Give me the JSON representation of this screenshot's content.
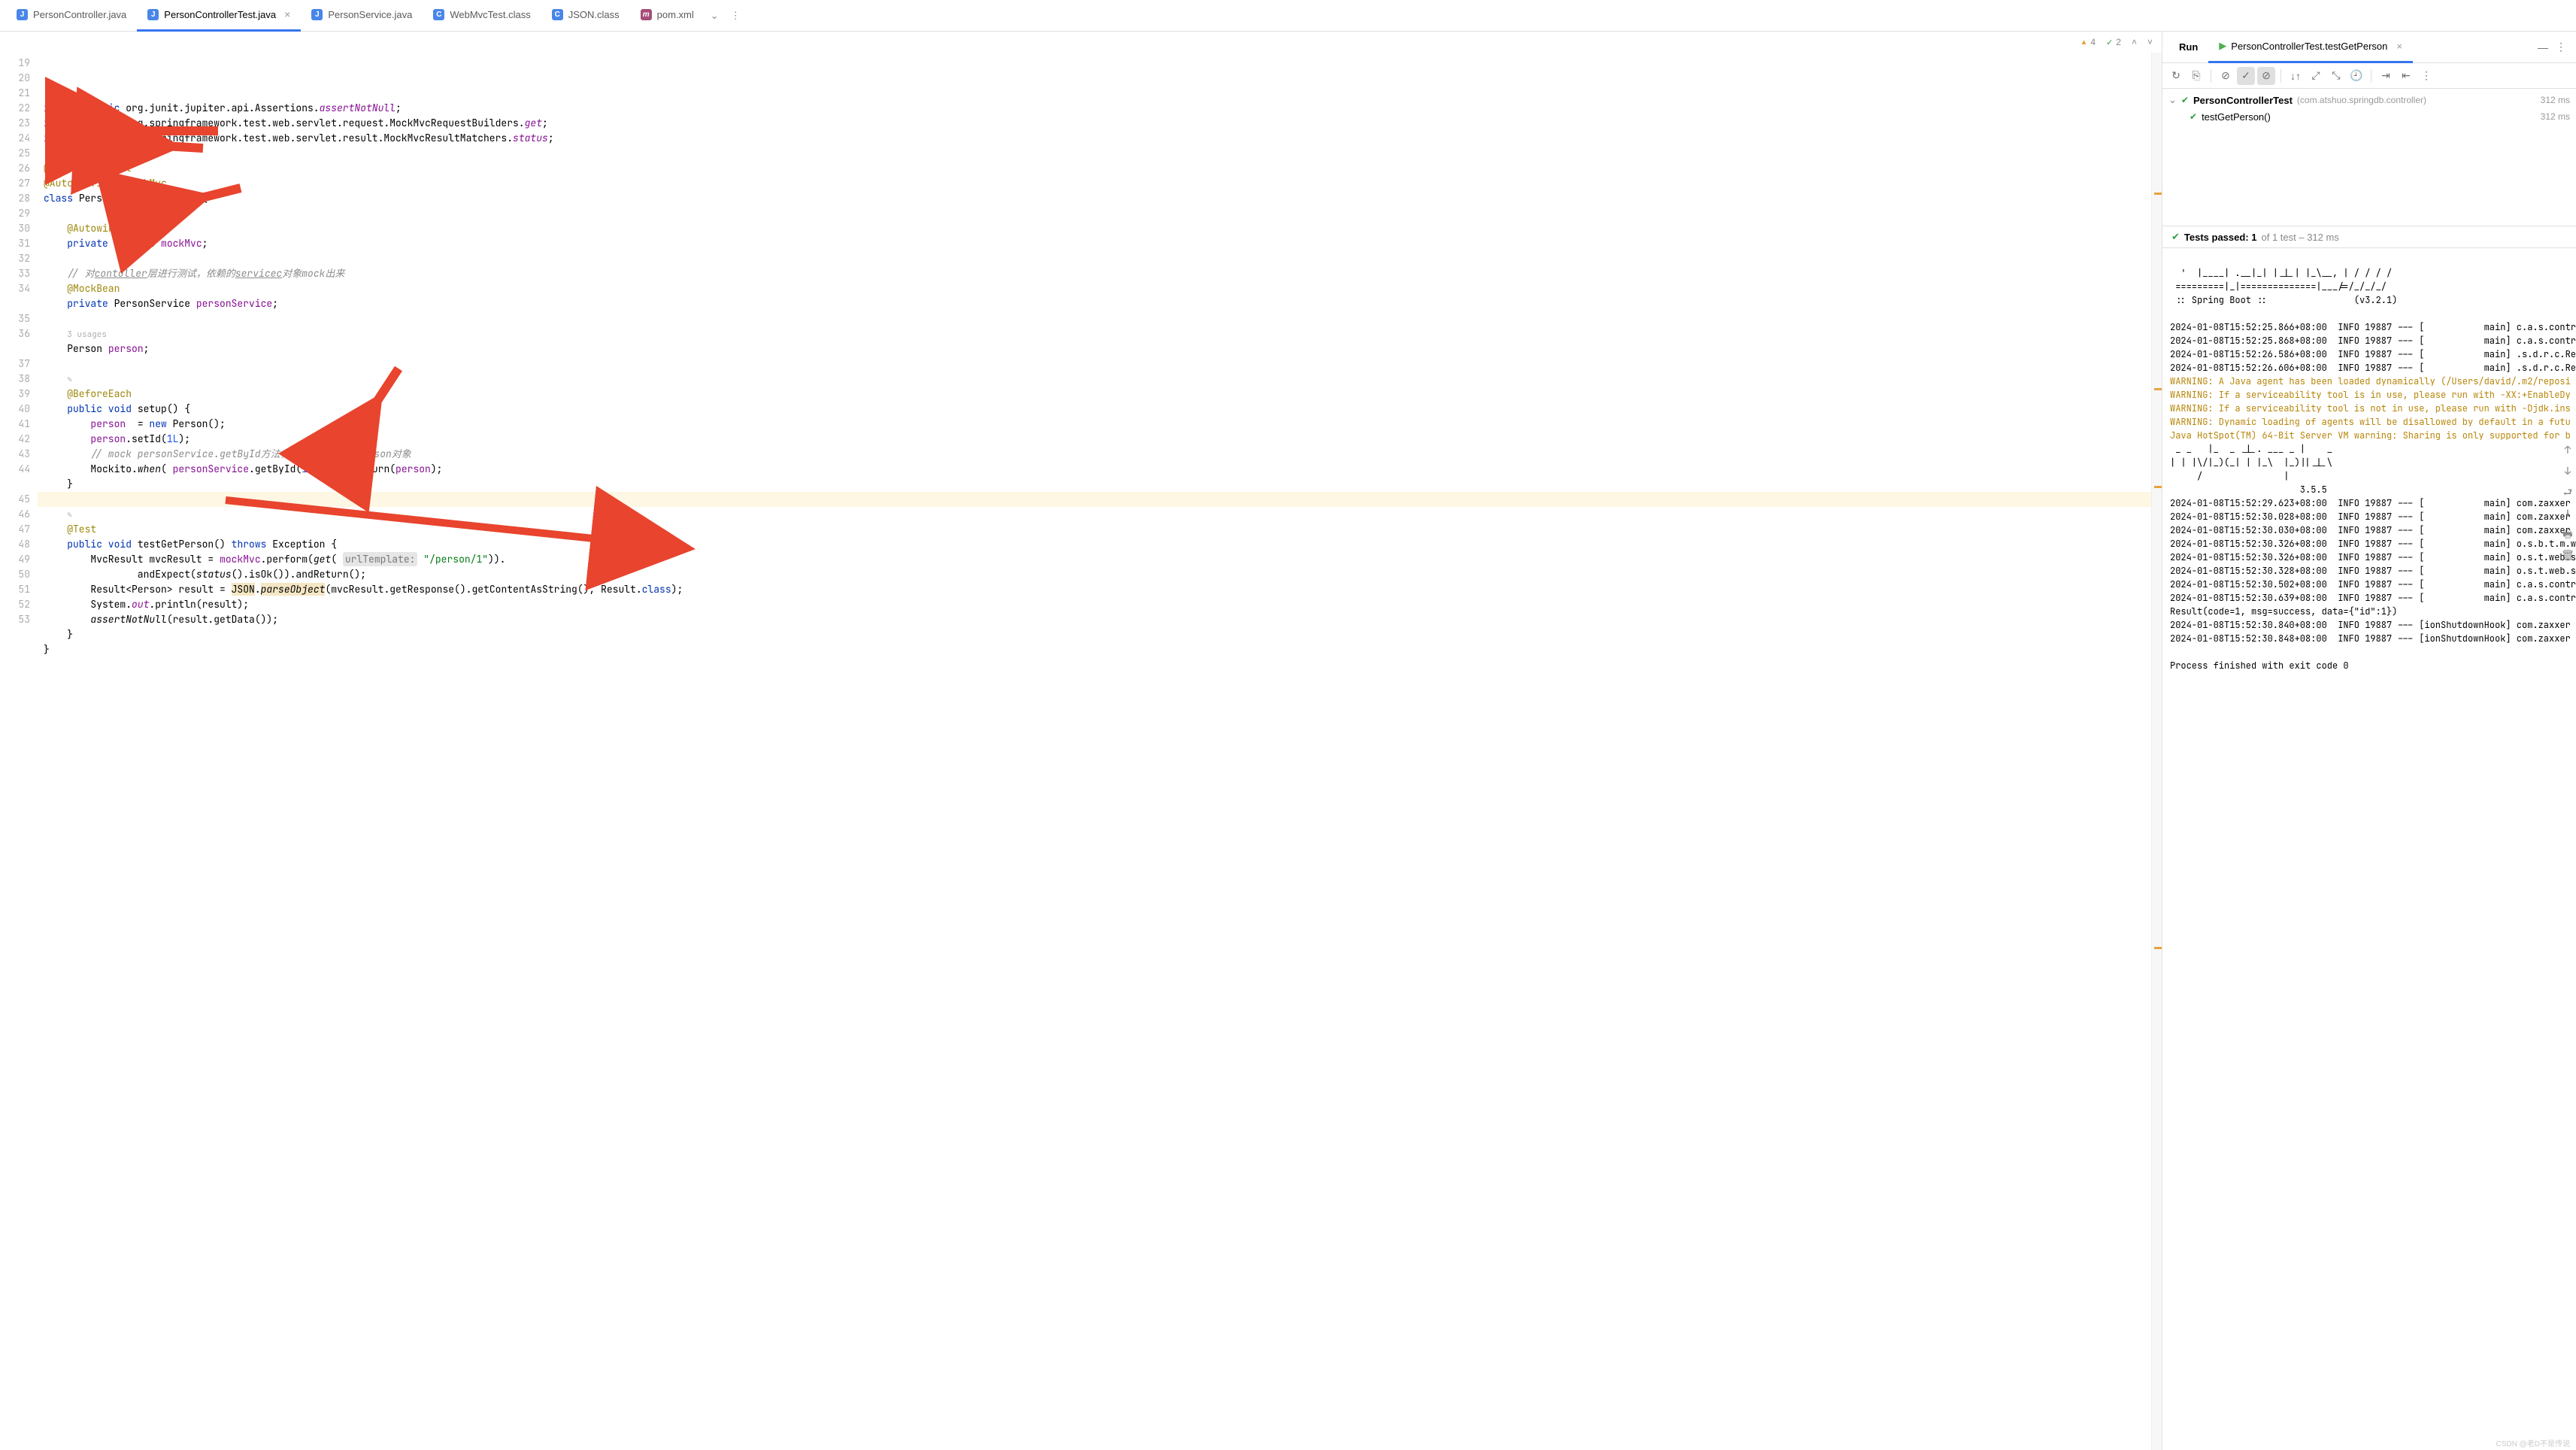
{
  "tabs": [
    {
      "icon": "java",
      "label": "PersonController.java"
    },
    {
      "icon": "java",
      "label": "PersonControllerTest.java",
      "active": true
    },
    {
      "icon": "java",
      "label": "PersonService.java"
    },
    {
      "icon": "cls",
      "label": "WebMvcTest.class"
    },
    {
      "icon": "cls",
      "label": "JSON.class"
    },
    {
      "icon": "m",
      "label": "pom.xml"
    }
  ],
  "editor": {
    "warn_count": "4",
    "ok_count": "2",
    "lines": [
      {
        "n": "19"
      },
      {
        "n": "20",
        "h": "<span class='k'>import static</span> org.junit.jupiter.api.Assertions.<span class='s-i'>assertNotNull</span>;"
      },
      {
        "n": "21",
        "h": "<span class='k'>import static</span> org.springframework.test.web.servlet.request.MockMvcRequestBuilders.<span class='s-i'>get</span>;"
      },
      {
        "n": "22",
        "h": "<span class='k'>import static</span> org.springframework.test.web.servlet.result.MockMvcResultMatchers.<span class='s-i'>status</span>;"
      },
      {
        "n": "23"
      },
      {
        "n": "24",
        "g": "r",
        "h": "<span class='ann'>@SpringBootTest</span>"
      },
      {
        "n": "25",
        "h": "<span class='ann'>@AutoConfigureMockMvc</span>"
      },
      {
        "n": "26",
        "g": "c",
        "h": "<span class='k'>class</span> <span class='type'>PersonControllerTest</span> {"
      },
      {
        "n": "27"
      },
      {
        "n": "28",
        "h": "    <span class='ann'>@Autowired</span>"
      },
      {
        "n": "29",
        "g": "n",
        "h": "    <span class='k'>private</span> MockMvc <span class='fld'>mockMvc</span>;"
      },
      {
        "n": "30"
      },
      {
        "n": "31",
        "h": "    <span class='cmt'>// 对<u>contoller</u>层进行测试，依赖的<u>servicec</u>对象mock出来</span>"
      },
      {
        "n": "32",
        "h": "    <span class='ann'>@MockBean</span>"
      },
      {
        "n": "33",
        "h": "    <span class='k'>private</span> PersonService <span class='fld'>personService</span>;"
      },
      {
        "n": "34"
      },
      {
        "n": "",
        "h": "    <span style='color:#b0b0b0;font-size:11px'>3 usages</span>"
      },
      {
        "n": "35",
        "h": "    Person <span class='fld'>person</span>;"
      },
      {
        "n": "36"
      },
      {
        "n": "",
        "h": "    <span style='color:#b0b0b0;font-size:11px'>✎</span>"
      },
      {
        "n": "37",
        "h": "    <span class='ann'>@BeforeEach</span>"
      },
      {
        "n": "38",
        "h": "    <span class='k'>public void</span> <span class='fn'>setup</span>() {"
      },
      {
        "n": "39",
        "h": "        <span class='fld'>person</span>  = <span class='k'>new</span> Person();"
      },
      {
        "n": "40",
        "h": "        <span class='fld'>person</span>.setId(<span class='num'>1L</span>);"
      },
      {
        "n": "41",
        "h": "        <span class='cmt'>// mock personService.getById方法，当id为1时返回person对象</span>"
      },
      {
        "n": "42",
        "h": "        Mockito.<span class='it'>when</span>( <span class='fld'>personService</span>.getById(<span class='num'>1L</span>)).thenReturn(<span class='fld'>person</span>);"
      },
      {
        "n": "43",
        "h": "    }"
      },
      {
        "n": "44",
        "hl": true
      },
      {
        "n": "",
        "h": "    <span style='color:#b0b0b0;font-size:11px'>✎</span>"
      },
      {
        "n": "45",
        "h": "    <span class='ann'>@Test</span>"
      },
      {
        "n": "46",
        "g": "c",
        "h": "    <span class='k'>public void</span> <span class='fn'>testGetPerson</span>() <span class='k'>throws</span> Exception {"
      },
      {
        "n": "47",
        "h": "        MvcResult mvcResult = <span class='fld'>mockMvc</span>.perform(<span class='it'>get</span>( <span class='hlbox'>urlTemplate:</span> <span class='str'>\"/person/1\"</span>))."
      },
      {
        "n": "48",
        "h": "                andExpect(<span class='it'>status</span>().isOk()).andReturn();"
      },
      {
        "n": "49",
        "h": "        Result&lt;Person&gt; result = <span class='hlw'>JSON</span>.<span class='it hlw'>parseObject</span>(mvcResult.getResponse().getContentAsString(), Result.<span class='k'>class</span>);"
      },
      {
        "n": "50",
        "h": "        System.<span class='s-i'>out</span>.println(result);"
      },
      {
        "n": "51",
        "h": "        <span class='it'>assertNotNull</span>(result.getData());"
      },
      {
        "n": "52",
        "h": "    }"
      },
      {
        "n": "53",
        "h": "}"
      }
    ]
  },
  "run": {
    "title": "Run",
    "tab": "PersonControllerTest.testGetPerson",
    "tree_root": "PersonControllerTest",
    "tree_pkg": "(com.atshuo.springdb.controller)",
    "tree_root_time": "312 ms",
    "tree_child": "testGetPerson()",
    "tree_child_time": "312 ms",
    "status": "Tests passed: 1",
    "status_tail": " of 1 test – 312 ms",
    "console": "  '  |____| .__|_| |_|_| |_\\__, | / / / /\n =========|_|==============|___/=/_/_/_/\n :: Spring Boot ::                (v3.2.1)\n\n2024-01-08T15:52:25.866+08:00  INFO 19887 --- [           main] c.a.s.contr\n2024-01-08T15:52:25.868+08:00  INFO 19887 --- [           main] c.a.s.contr\n2024-01-08T15:52:26.586+08:00  INFO 19887 --- [           main] .s.d.r.c.Re\n2024-01-08T15:52:26.606+08:00  INFO 19887 --- [           main] .s.d.r.c.Re",
    "console_warn": "WARNING: A Java agent has been loaded dynamically (/Users/david/.m2/reposi\nWARNING: If a serviceability tool is in use, please run with -XX:+EnableDy\nWARNING: If a serviceability tool is not in use, please run with -Djdk.ins\nWARNING: Dynamic loading of agents will be disallowed by default in a futu\nJava HotSpot(TM) 64-Bit Server VM warning: Sharing is only supported for b",
    "console2": " _ _   |_  _ _|_. ___ _ |    _\n| | |\\/|_)(_| | |_\\  |_)||_|_\\\n     /               |\n                        3.5.5\n2024-01-08T15:52:29.623+08:00  INFO 19887 --- [           main] com.zaxxer\n2024-01-08T15:52:30.028+08:00  INFO 19887 --- [           main] com.zaxxer\n2024-01-08T15:52:30.030+08:00  INFO 19887 --- [           main] com.zaxxer\n2024-01-08T15:52:30.326+08:00  INFO 19887 --- [           main] o.s.b.t.m.w\n2024-01-08T15:52:30.326+08:00  INFO 19887 --- [           main] o.s.t.web.s\n2024-01-08T15:52:30.328+08:00  INFO 19887 --- [           main] o.s.t.web.s\n2024-01-08T15:52:30.502+08:00  INFO 19887 --- [           main] c.a.s.contr\n2024-01-08T15:52:30.639+08:00  INFO 19887 --- [           main] c.a.s.contr\nResult(code=1, msg=success, data={\"id\":1})\n2024-01-08T15:52:30.840+08:00  INFO 19887 --- [ionShutdownHook] com.zaxxer\n2024-01-08T15:52:30.848+08:00  INFO 19887 --- [ionShutdownHook] com.zaxxer\n\nProcess finished with exit code 0"
  },
  "watermark": "CSDN @老D不是传说"
}
